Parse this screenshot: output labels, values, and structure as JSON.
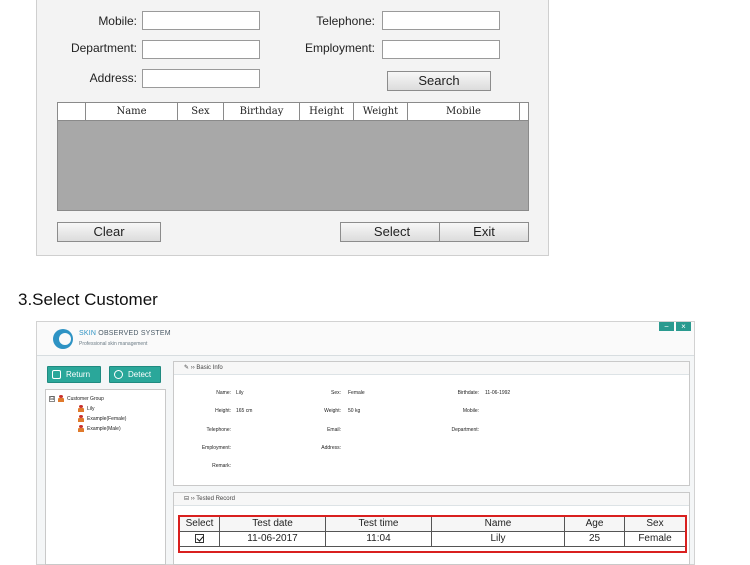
{
  "search_dialog": {
    "labels": {
      "mobile": "Mobile:",
      "telephone": "Telephone:",
      "department": "Department:",
      "employment": "Employment:",
      "address": "Address:"
    },
    "buttons": {
      "search": "Search",
      "clear": "Clear",
      "select": "Select",
      "exit": "Exit"
    },
    "grid_columns": [
      "Name",
      "Sex",
      "Birthday",
      "Height",
      "Weight",
      "Mobile"
    ]
  },
  "section_heading": "3.Select Customer",
  "app": {
    "brand_skin": "SKIN",
    "brand_rest": "OBSERVED SYSTEM",
    "slogan": "Professional skin management",
    "window_controls": {
      "minimize": "−",
      "close": "×"
    },
    "toolbar": {
      "return": "Return",
      "detect": "Detect"
    },
    "tree": {
      "expander": "⊟",
      "root": "Customer Group",
      "children": [
        "Lily",
        "Example(Female)",
        "Example(Male)"
      ]
    },
    "basic_info": {
      "title": "›› Basic Info",
      "fields": {
        "name_label": "Name:",
        "name_value": "Lily",
        "sex_label": "Sex:",
        "sex_value": "Female",
        "birthdate_label": "Birthdate:",
        "birthdate_value": "11-06-1992",
        "height_label": "Height:",
        "height_value": "165 cm",
        "weight_label": "Weight:",
        "weight_value": "50 kg",
        "mobile_label": "Mobile:",
        "telephone_label": "Telephone:",
        "email_label": "Email:",
        "department_label": "Department:",
        "employment_label": "Employment:",
        "address_label": "Address:",
        "remark_label": "Remark:"
      }
    },
    "tested_record": {
      "title": "›› Tested Record",
      "columns": [
        "Select",
        "Test date",
        "Test time",
        "Name",
        "Age",
        "Sex"
      ],
      "rows": [
        {
          "selected": true,
          "test_date": "11-06-2017",
          "test_time": "11:04",
          "name": "Lily",
          "age": "25",
          "sex": "Female"
        }
      ]
    },
    "colors": {
      "accent": "#2aa79a",
      "highlight_border": "#d9201f",
      "brand_blue": "#2e93c4"
    }
  }
}
